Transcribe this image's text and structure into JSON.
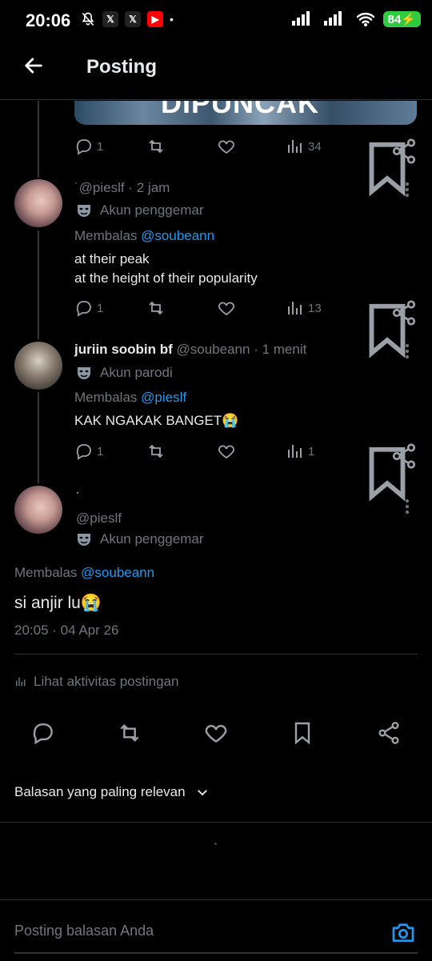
{
  "status_bar": {
    "time": "20:06",
    "battery": "84",
    "app_icons": [
      "mute-icon",
      "x-icon",
      "x-icon",
      "youtube-icon"
    ]
  },
  "header": {
    "title": "Posting"
  },
  "media_overlay_text": "DIPUNCAK",
  "post_actions_1": {
    "replies": "1",
    "views": "34"
  },
  "reply1": {
    "handle": "@pieslf",
    "time": "· 2 jam",
    "badge": "Akun penggemar",
    "replying_label": "Membalas",
    "replying_to": "@soubeann",
    "lines": [
      "at their peak",
      "at the height of their popularity"
    ],
    "replies": "1",
    "views": "13"
  },
  "reply2": {
    "name": "juriin soobin bf",
    "handle": "@soubeann",
    "time": "· 1 menit",
    "badge": "Akun parodi",
    "replying_label": "Membalas",
    "replying_to": "@pieslf",
    "text": "KAK NGAKAK BANGET😭",
    "replies": "1",
    "views": "1"
  },
  "focus_post": {
    "handle": "@pieslf",
    "badge": "Akun penggemar",
    "replying_label": "Membalas",
    "replying_to": "@soubeann",
    "text": "si anjir lu😭",
    "timestamp": "20:05 · 04 Apr 26",
    "activity_label": "Lihat aktivitas postingan"
  },
  "sort": {
    "label": "Balasan yang paling relevan"
  },
  "reply_box": {
    "placeholder": "Posting balasan Anda"
  },
  "colors": {
    "background": "#000000",
    "text": "#e7e9ea",
    "muted": "#71767b",
    "link": "#1d9bf0",
    "battery": "#2ecc40"
  }
}
